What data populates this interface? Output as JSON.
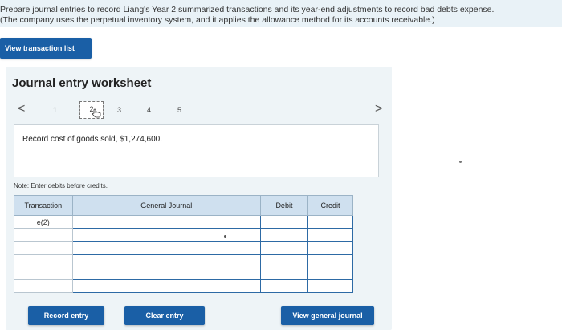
{
  "instructions": {
    "line1": "Prepare journal entries to record Liang's Year 2 summarized transactions and its year-end adjustments to record bad debts expense.",
    "line2": "(The company uses the perpetual inventory system, and it applies the allowance method for its accounts receivable.)"
  },
  "buttons": {
    "view_transaction_list": "View transaction list",
    "record_entry": "Record entry",
    "clear_entry": "Clear entry",
    "view_general_journal": "View general journal"
  },
  "worksheet": {
    "title": "Journal entry worksheet",
    "pager": {
      "prev": "<",
      "next": ">",
      "pages": [
        "1",
        "2",
        "3",
        "4",
        "5"
      ],
      "current": "2"
    },
    "description": "Record cost of goods sold, $1,274,600.",
    "note": "Note: Enter debits before credits."
  },
  "table": {
    "headers": {
      "transaction": "Transaction",
      "general_journal": "General Journal",
      "debit": "Debit",
      "credit": "Credit"
    },
    "first_transaction": "e(2)",
    "row_count": 6
  },
  "colors": {
    "button_blue": "#1a5fa6",
    "header_blue": "#cfe0ef",
    "panel_bg": "#eef4f7",
    "instructions_bg": "#e9f2f7"
  }
}
